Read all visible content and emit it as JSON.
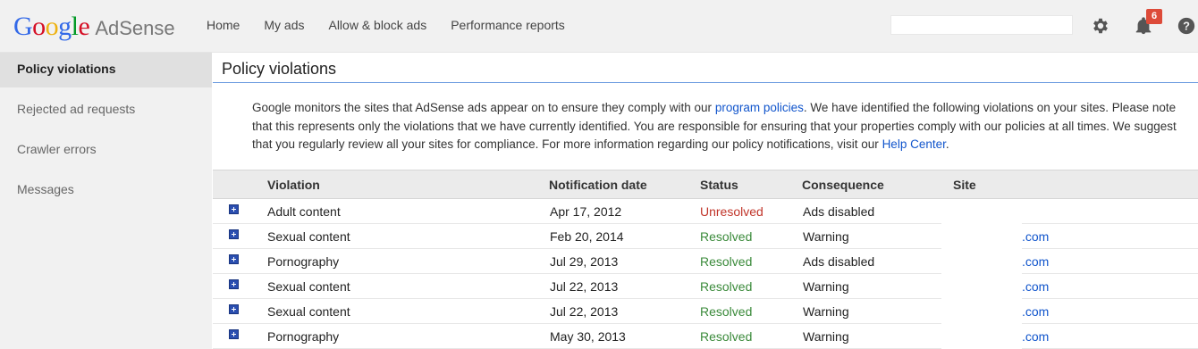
{
  "header": {
    "logo_google": [
      "G",
      "o",
      "o",
      "g",
      "l",
      "e"
    ],
    "logo_product": "AdSense",
    "nav": [
      "Home",
      "My ads",
      "Allow & block ads",
      "Performance reports"
    ],
    "search_value": "",
    "notifications_count": "6"
  },
  "sidebar": {
    "items": [
      {
        "label": "Policy violations",
        "active": true
      },
      {
        "label": "Rejected ad requests"
      },
      {
        "label": "Crawler errors"
      },
      {
        "label": "Messages"
      }
    ]
  },
  "main": {
    "title": "Policy violations",
    "intro": {
      "part1": "Google monitors the sites that AdSense ads appear on to ensure they comply with our ",
      "link1": "program policies",
      "part2": ". We have identified the following violations on your sites. Please note that this represents only the violations that we have currently identified. You are responsible for ensuring that your properties comply with our policies at all times. We suggest that you regularly review all your sites for compliance. For more information regarding our policy notifications, visit our ",
      "link2": "Help Center",
      "part3": "."
    },
    "table": {
      "headers": [
        "Violation",
        "Notification date",
        "Status",
        "Consequence",
        "Site"
      ],
      "rows": [
        {
          "violation": "Adult content",
          "date": "Apr 17, 2012",
          "status": "Unresolved",
          "consequence": "Ads disabled",
          "site": ""
        },
        {
          "violation": "Sexual content",
          "date": "Feb 20, 2014",
          "status": "Resolved",
          "consequence": "Warning",
          "site": ".com"
        },
        {
          "violation": "Pornography",
          "date": "Jul 29, 2013",
          "status": "Resolved",
          "consequence": "Ads disabled",
          "site": ".com"
        },
        {
          "violation": "Sexual content",
          "date": "Jul 22, 2013",
          "status": "Resolved",
          "consequence": "Warning",
          "site": ".com"
        },
        {
          "violation": "Sexual content",
          "date": "Jul 22, 2013",
          "status": "Resolved",
          "consequence": "Warning",
          "site": ".com"
        },
        {
          "violation": "Pornography",
          "date": "May 30, 2013",
          "status": "Resolved",
          "consequence": "Warning",
          "site": ".com"
        }
      ]
    }
  },
  "colors": {
    "unresolved": "#c1352a",
    "resolved": "#3a8a3a",
    "link": "#1155cc",
    "badge": "#dd4b39"
  },
  "icons": [
    "settings-gear-icon",
    "notifications-bell-icon",
    "help-icon",
    "expand-plus-icon"
  ]
}
